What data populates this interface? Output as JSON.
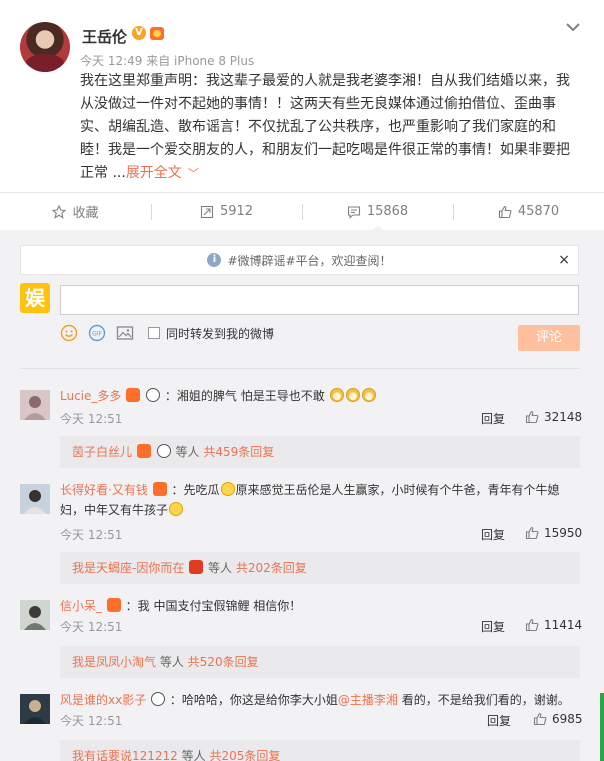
{
  "post": {
    "username": "王岳伦",
    "verified_badge": "V",
    "meta": "今天 12:49 来自 iPhone 8 Plus",
    "text": "我在这里郑重声明：我这辈子最爱的人就是我老婆李湘！自从我们结婚以来，我从没做过一件对不起她的事情！！这两天有些无良媒体通过偷拍借位、歪曲事实、胡编乱造、散布谣言！不仅扰乱了公共秩序，也严重影响了我们家庭的和睦！我是一个爱交朋友的人，和朋友们一起吃喝是件很正常的事情！如果非要把正常 ...",
    "expand_label": "展开全文",
    "icons": {
      "menu": "chevron-down-icon",
      "expand": "chevron-down-icon"
    }
  },
  "actions": [
    {
      "label": "收藏",
      "icon": "star-icon"
    },
    {
      "label": "5912",
      "icon": "repost-icon"
    },
    {
      "label": "15868",
      "icon": "comment-icon"
    },
    {
      "label": "45870",
      "icon": "thumbs-up-icon"
    }
  ],
  "notice": {
    "text": "#微博辟谣#平台，欢迎查阅！",
    "close": "×"
  },
  "compose": {
    "logo": "娱",
    "input_value": "",
    "repost_label": "同时转发到我的微博",
    "submit_label": "评论"
  },
  "comments": [
    {
      "user": "Lucie_多多",
      "text_before": "：湘姐的脾气 怕是王导也不敢",
      "text_after": "",
      "time": "今天 12:51",
      "reply": "回复",
      "likes": "32148",
      "sub": {
        "user": "茵子白丝儿",
        "mid": " 等人 ",
        "count": "共459条回复"
      }
    },
    {
      "user": "长得好看·又有钱",
      "text_before": "：先吃瓜",
      "text_middle": "原来感觉王岳伦是人生赢家，小时候有个牛爸，青年有个牛媳妇，中年又有牛孩子",
      "time": "今天 12:51",
      "reply": "回复",
      "likes": "15950",
      "sub": {
        "user": "我是天蝎座-因你而在",
        "mid": " 等人 ",
        "count": "共202条回复"
      }
    },
    {
      "user": "信小呆_",
      "text_before": "：我 中国支付宝假锦鲤 相信你！",
      "time": "今天 12:51",
      "reply": "回复",
      "likes": "11414",
      "sub": {
        "user": "我是凤凤小淘气",
        "mid": " 等人 ",
        "count": "共520条回复"
      }
    },
    {
      "user": "风是谁的xx影子",
      "text_before": "：哈哈哈，你这是给你李大小姐",
      "mention": "@主播李湘",
      "text_after": " 看的，不是给我们看的，谢谢。",
      "time": "今天 12:51",
      "reply": "回复",
      "likes": "6985",
      "sub": {
        "user": "我有话要说121212",
        "mid": " 等人 ",
        "count": "共205条回复"
      }
    }
  ],
  "colors": {
    "accent": "#eb7350",
    "background": "#f2f2f5",
    "submit": "#ffc09f",
    "logo": "#ffc20e"
  }
}
